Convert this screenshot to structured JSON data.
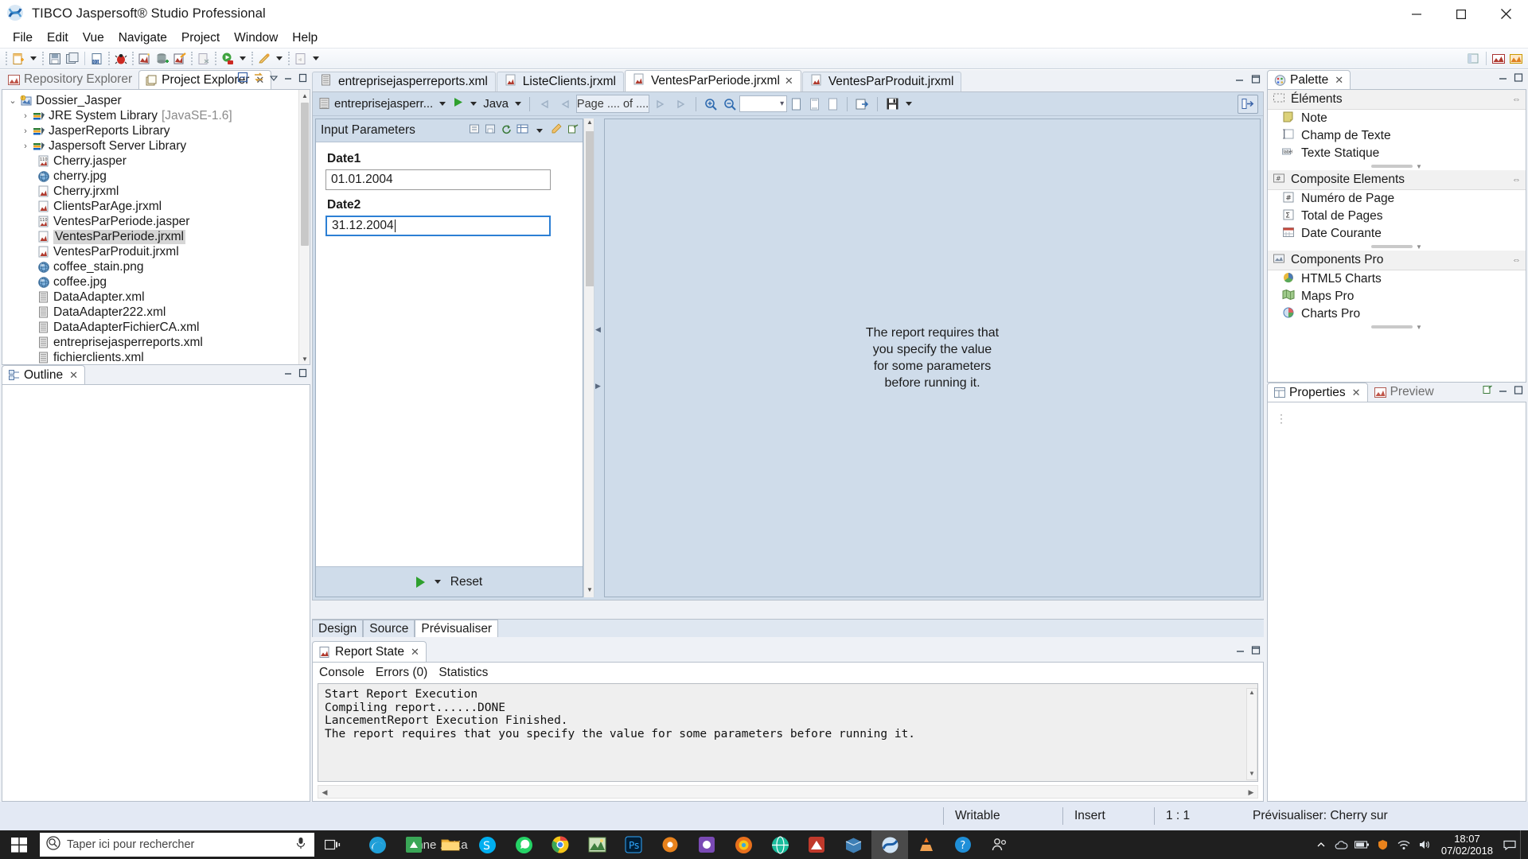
{
  "window": {
    "title": "TIBCO Jaspersoft® Studio Professional",
    "app_icon": "jaspersoft-icon",
    "minimize": "minimize-icon",
    "maximize": "maximize-icon",
    "close": "close-icon"
  },
  "menubar": {
    "items": [
      "File",
      "Edit",
      "Vue",
      "Navigate",
      "Project",
      "Window",
      "Help"
    ]
  },
  "toolbar": {
    "icons": [
      "new-file-icon",
      "save-icon",
      "save-all-icon",
      "compile-report-icon",
      "debug-icon",
      "preview-icon",
      "datasource-icon",
      "wizard-icon",
      "export-icon",
      "run-icon",
      "paint-icon",
      "publish-icon"
    ]
  },
  "left": {
    "tabs": [
      {
        "label": "Repository Explorer",
        "icon": "repository-icon",
        "active": false,
        "closable": false
      },
      {
        "label": "Project Explorer",
        "icon": "project-icon",
        "active": true,
        "closable": true
      }
    ],
    "controls": [
      "collapse-all-icon",
      "link-editor-icon",
      "view-menu-icon",
      "minimize-icon",
      "maximize-icon"
    ],
    "tree": [
      {
        "label": "Dossier_Jasper",
        "sub": "",
        "icon": "project-folder-icon",
        "twist": "v",
        "indent": 0,
        "selected": false
      },
      {
        "label": "JRE System Library",
        "sub": "[JavaSE-1.6]",
        "icon": "library-icon",
        "twist": ">",
        "indent": 1,
        "selected": false
      },
      {
        "label": "JasperReports Library",
        "sub": "",
        "icon": "library-icon",
        "twist": ">",
        "indent": 1,
        "selected": false
      },
      {
        "label": "Jaspersoft Server Library",
        "sub": "",
        "icon": "library-icon",
        "twist": ">",
        "indent": 1,
        "selected": false
      },
      {
        "label": "Cherry.jasper",
        "sub": "",
        "icon": "jasper-file-icon",
        "twist": "",
        "indent": 1,
        "selected": false
      },
      {
        "label": "cherry.jpg",
        "sub": "",
        "icon": "image-file-icon",
        "twist": "",
        "indent": 1,
        "selected": false
      },
      {
        "label": "Cherry.jrxml",
        "sub": "",
        "icon": "jrxml-file-icon",
        "twist": "",
        "indent": 1,
        "selected": false
      },
      {
        "label": "ClientsParAge.jrxml",
        "sub": "",
        "icon": "jrxml-file-icon",
        "twist": "",
        "indent": 1,
        "selected": false
      },
      {
        "label": "VentesParPeriode.jasper",
        "sub": "",
        "icon": "jasper-file-icon",
        "twist": "",
        "indent": 1,
        "selected": false
      },
      {
        "label": "VentesParPeriode.jrxml",
        "sub": "",
        "icon": "jrxml-file-icon",
        "twist": "",
        "indent": 1,
        "selected": true
      },
      {
        "label": "VentesParProduit.jrxml",
        "sub": "",
        "icon": "jrxml-file-icon",
        "twist": "",
        "indent": 1,
        "selected": false
      },
      {
        "label": "coffee_stain.png",
        "sub": "",
        "icon": "image-file-icon",
        "twist": "",
        "indent": 1,
        "selected": false
      },
      {
        "label": "coffee.jpg",
        "sub": "",
        "icon": "image-file-icon",
        "twist": "",
        "indent": 1,
        "selected": false
      },
      {
        "label": "DataAdapter.xml",
        "sub": "",
        "icon": "xml-file-icon",
        "twist": "",
        "indent": 1,
        "selected": false
      },
      {
        "label": "DataAdapter222.xml",
        "sub": "",
        "icon": "xml-file-icon",
        "twist": "",
        "indent": 1,
        "selected": false
      },
      {
        "label": "DataAdapterFichierCA.xml",
        "sub": "",
        "icon": "xml-file-icon",
        "twist": "",
        "indent": 1,
        "selected": false
      },
      {
        "label": "entreprisejasperreports.xml",
        "sub": "",
        "icon": "xml-file-icon",
        "twist": "",
        "indent": 1,
        "selected": false
      },
      {
        "label": "fichierclients.xml",
        "sub": "",
        "icon": "xml-file-icon",
        "twist": "",
        "indent": 1,
        "selected": false
      }
    ],
    "outline": {
      "tab_label": "Outline",
      "icon": "outline-icon",
      "closable": true
    }
  },
  "editor": {
    "tabs": [
      {
        "label": "entreprisejasperreports.xml",
        "icon": "xml-file-icon",
        "active": false,
        "closable": false
      },
      {
        "label": "ListeClients.jrxml",
        "icon": "jrxml-file-icon",
        "active": false,
        "closable": false
      },
      {
        "label": "VentesParPeriode.jrxml",
        "icon": "jrxml-file-icon",
        "active": true,
        "closable": true
      },
      {
        "label": "VentesParProduit.jrxml",
        "icon": "jrxml-file-icon",
        "active": false,
        "closable": false
      }
    ],
    "controls": [
      "minimize-icon",
      "maximize-icon"
    ],
    "preview_toolbar": {
      "datasource": "entreprisejasperr...",
      "datasource_icon": "xml-file-icon",
      "run_icon": "run-report-icon",
      "language": "Java",
      "nav_first_icon": "first-page-icon",
      "nav_prev_icon": "previous-page-icon",
      "page_indicator": "Page .... of ....",
      "nav_next_icon": "next-page-icon",
      "nav_last_icon": "last-page-icon",
      "zoom_in_icon": "zoom-in-icon",
      "zoom_out_icon": "zoom-out-icon",
      "zoom_value": "",
      "fit_page_icon": "fit-page-icon",
      "fit_height_icon": "fit-height-icon",
      "actual_size_icon": "actual-size-icon",
      "export_icon": "export-icon",
      "save_icon": "save-icon",
      "toggle_params_icon": "toggle-parameters-panel-icon"
    },
    "parameters": {
      "title": "Input Parameters",
      "header_icons": [
        "load-params-icon",
        "save-params-icon",
        "refresh-params-icon",
        "grid-params-icon",
        "params-menu-icon",
        "clear-params-icon",
        "detach-params-icon"
      ],
      "fields": [
        {
          "label": "Date1",
          "value": "01.01.2004",
          "focused": false
        },
        {
          "label": "Date2",
          "value": "31.12.2004",
          "focused": true
        }
      ],
      "run_label": "",
      "reset_label": "Reset",
      "run_icon": "run-icon"
    },
    "canvas_message": [
      "The report requires that",
      "you specify the value",
      "for some parameters",
      "before running it."
    ],
    "bottom_tabs": [
      {
        "label": "Design",
        "active": false
      },
      {
        "label": "Source",
        "active": false
      },
      {
        "label": "Prévisualiser",
        "active": true
      }
    ]
  },
  "console": {
    "tab_label": "Report State",
    "tab_icon": "jrxml-file-icon",
    "tab_closable": true,
    "controls": [
      "minimize-icon",
      "maximize-icon"
    ],
    "subtabs": [
      "Console",
      "Errors (0)",
      "Statistics"
    ],
    "lines": [
      "Start Report Execution",
      "Compiling report......DONE",
      "LancementReport Execution Finished.",
      "The report requires that you specify the value for some parameters before running it."
    ]
  },
  "palette": {
    "tab_label": "Palette",
    "tab_icon": "palette-icon",
    "tab_closable": true,
    "controls": [
      "minimize-icon",
      "maximize-icon"
    ],
    "groups": [
      {
        "name": "Éléments",
        "icon": "elements-group-icon",
        "items": [
          {
            "label": "Note",
            "icon": "note-icon"
          },
          {
            "label": "Champ de Texte",
            "icon": "text-field-icon"
          },
          {
            "label": "Texte Statique",
            "icon": "static-text-icon"
          }
        ]
      },
      {
        "name": "Composite Elements",
        "icon": "composite-group-icon",
        "items": [
          {
            "label": "Numéro de Page",
            "icon": "page-number-icon"
          },
          {
            "label": "Total de Pages",
            "icon": "total-pages-icon"
          },
          {
            "label": "Date Courante",
            "icon": "current-date-icon"
          }
        ]
      },
      {
        "name": "Components Pro",
        "icon": "components-pro-group-icon",
        "items": [
          {
            "label": "HTML5 Charts",
            "icon": "html5-charts-icon"
          },
          {
            "label": "Maps Pro",
            "icon": "maps-pro-icon"
          },
          {
            "label": "Charts Pro",
            "icon": "charts-pro-icon"
          }
        ]
      }
    ]
  },
  "properties": {
    "tabs": [
      {
        "label": "Properties",
        "icon": "properties-icon",
        "active": true,
        "closable": true
      },
      {
        "label": "Preview",
        "icon": "preview-icon",
        "active": false,
        "closable": false
      }
    ],
    "controls": [
      "pin-icon",
      "minimize-icon",
      "maximize-icon"
    ]
  },
  "statusbar": {
    "writable": "Writable",
    "insert": "Insert",
    "position": "1 : 1",
    "message": "Prévisualiser: Cherry sur"
  },
  "taskbar": {
    "start_icon": "windows-start-icon",
    "search_placeholder": "Taper ici pour rechercher",
    "search_icon": "search-circle-icon",
    "mic_icon": "microphone-icon",
    "taskview_icon": "task-view-icon",
    "apps": [
      {
        "name": "edge-icon",
        "active": false
      },
      {
        "name": "store-icon",
        "active": false
      },
      {
        "name": "file-explorer-icon",
        "active": false
      },
      {
        "name": "skype-icon",
        "active": false
      },
      {
        "name": "whatsapp-icon",
        "active": false
      },
      {
        "name": "chrome-icon",
        "active": false
      },
      {
        "name": "image-viewer-icon",
        "active": false
      },
      {
        "name": "photoshop-icon",
        "active": false
      },
      {
        "name": "settings-gear-icon",
        "active": false
      },
      {
        "name": "app-purple-icon",
        "active": false
      },
      {
        "name": "firefox-icon",
        "active": false
      },
      {
        "name": "browser-icon",
        "active": false
      },
      {
        "name": "app-red-icon",
        "active": false
      },
      {
        "name": "package-icon",
        "active": false
      },
      {
        "name": "jaspersoft-studio-icon",
        "active": true
      },
      {
        "name": "vlc-icon",
        "active": false
      },
      {
        "name": "help-icon",
        "active": false
      },
      {
        "name": "people-icon",
        "active": false
      }
    ],
    "tray": [
      "chevron-up-icon",
      "onedrive-icon",
      "battery-icon",
      "antivirus-icon",
      "network-icon",
      "volume-icon"
    ],
    "time": "18:07",
    "date": "07/02/2018",
    "notification_icon": "notifications-icon",
    "ghost_text": "onne ... Ka"
  }
}
